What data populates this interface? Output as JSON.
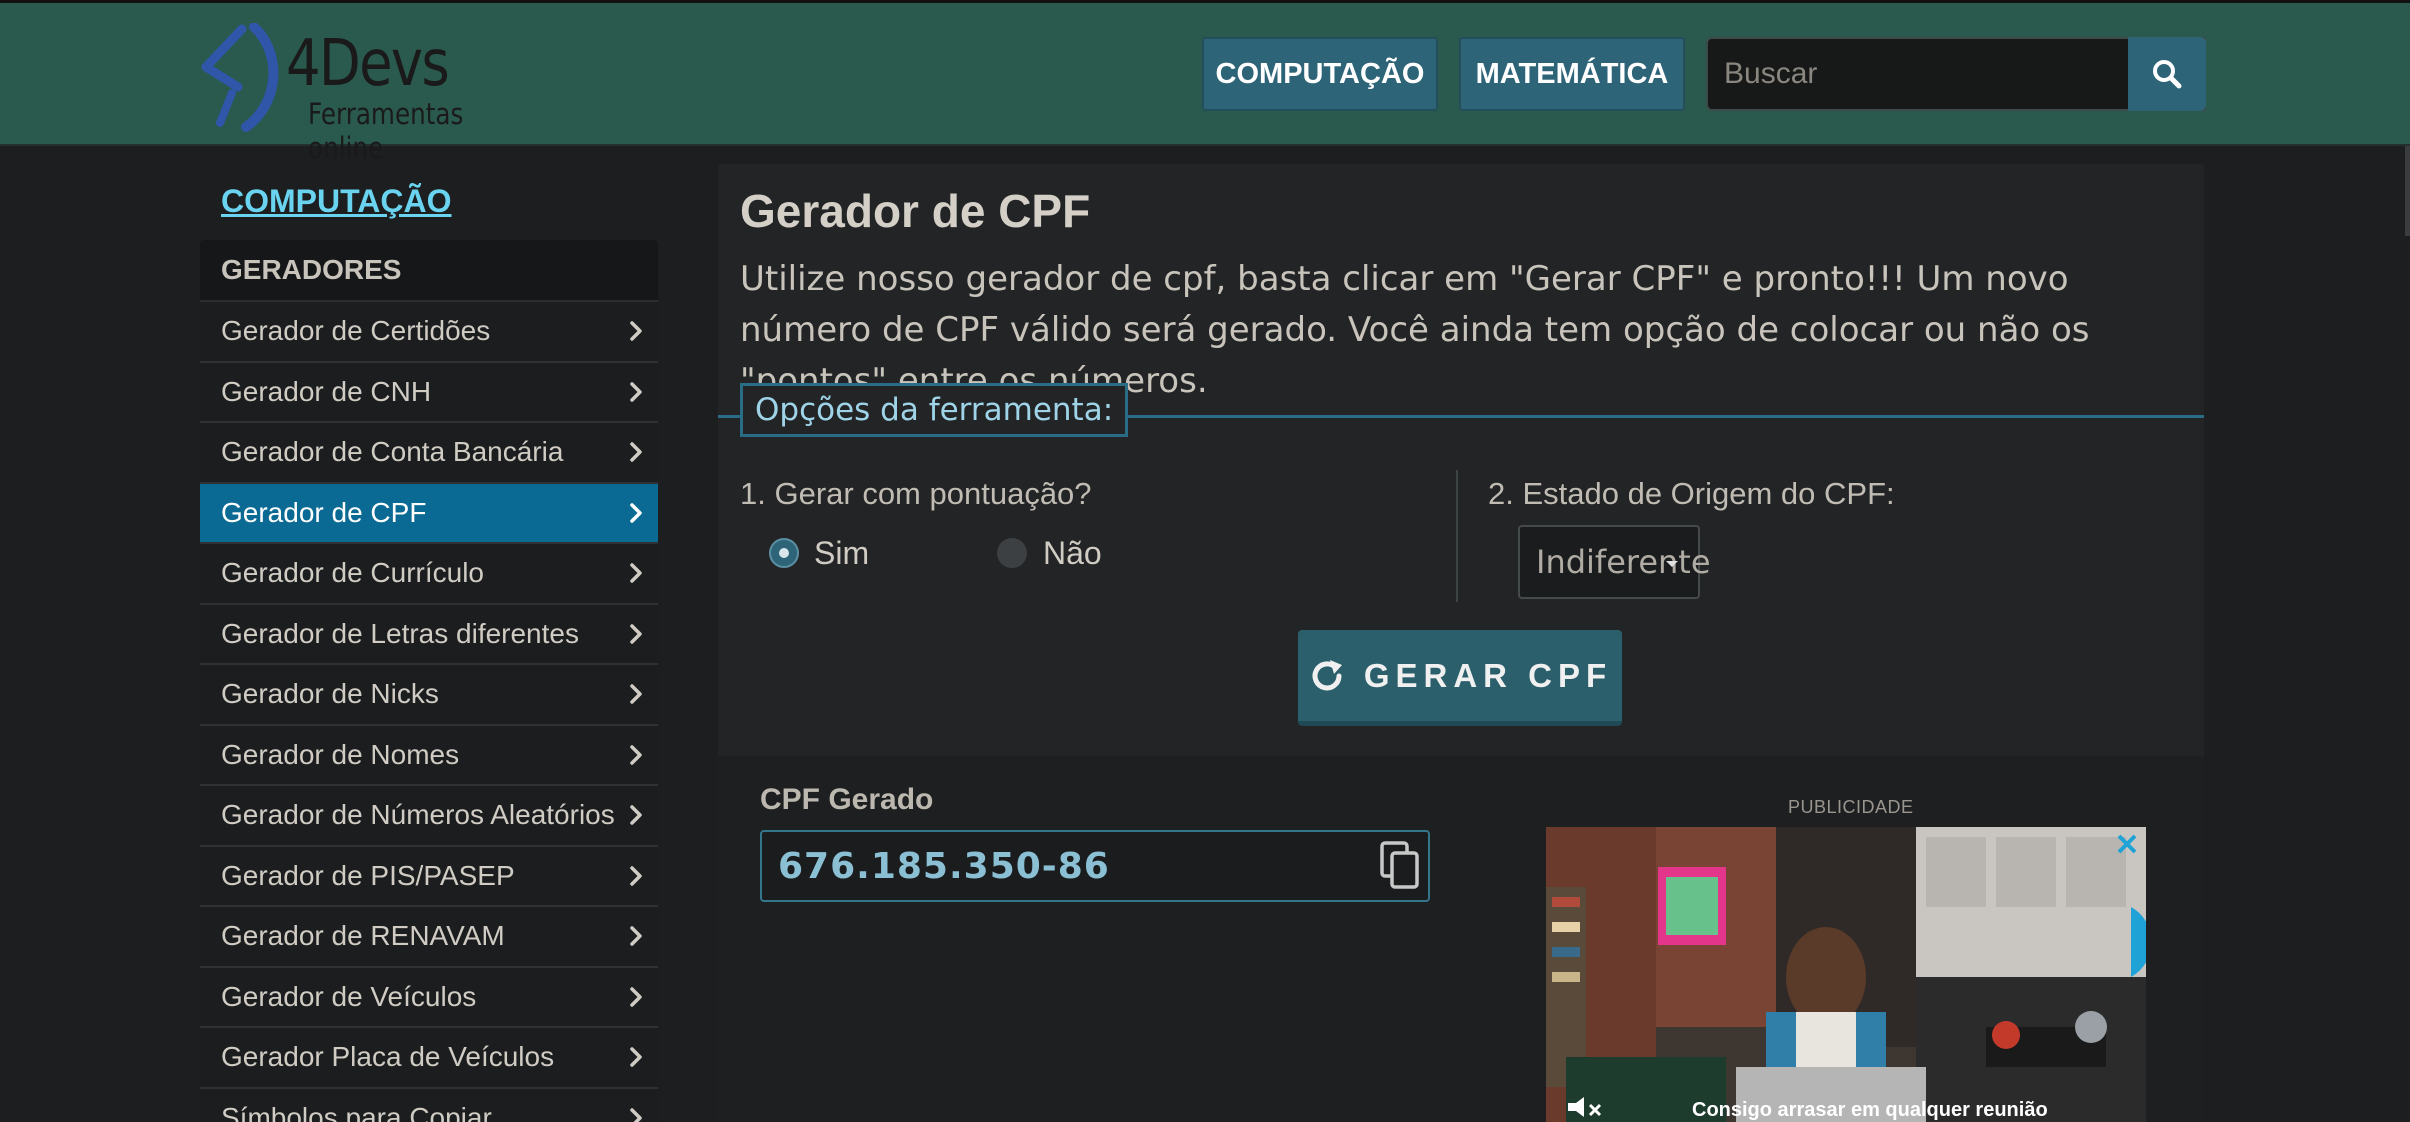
{
  "header": {
    "logo_title": "4Devs",
    "logo_subtitle": "Ferramentas online",
    "nav": [
      {
        "label": "COMPUTAÇÃO"
      },
      {
        "label": "MATEMÁTICA"
      }
    ],
    "search_placeholder": "Buscar",
    "search_icon": "search-icon"
  },
  "sidebar": {
    "heading": "COMPUTAÇÃO",
    "section": "GERADORES",
    "items": [
      {
        "label": "Gerador de Certidões",
        "active": false
      },
      {
        "label": "Gerador de CNH",
        "active": false
      },
      {
        "label": "Gerador de Conta Bancária",
        "active": false
      },
      {
        "label": "Gerador de CPF",
        "active": true
      },
      {
        "label": "Gerador de Currículo",
        "active": false
      },
      {
        "label": "Gerador de Letras diferentes",
        "active": false
      },
      {
        "label": "Gerador de Nicks",
        "active": false
      },
      {
        "label": "Gerador de Nomes",
        "active": false
      },
      {
        "label": "Gerador de Números Aleatórios",
        "active": false
      },
      {
        "label": "Gerador de PIS/PASEP",
        "active": false
      },
      {
        "label": "Gerador de RENAVAM",
        "active": false
      },
      {
        "label": "Gerador de Veículos",
        "active": false
      },
      {
        "label": "Gerador Placa de Veículos",
        "active": false
      },
      {
        "label": "Símbolos para Copiar",
        "active": false
      }
    ]
  },
  "main": {
    "title": "Gerador de CPF",
    "description": "Utilize nosso gerador de cpf, basta clicar em \"Gerar CPF\" e pronto!!! Um novo número de CPF válido será gerado. Você ainda tem opção de colocar ou não os \"pontos\" entre os números.",
    "options_legend": "Opções da ferramenta:",
    "option1_label": "1. Gerar com pontuação?",
    "option1_choices": [
      {
        "label": "Sim",
        "checked": true
      },
      {
        "label": "Não",
        "checked": false
      }
    ],
    "option2_label": "2. Estado de Origem do CPF:",
    "option2_value": "Indiferente",
    "generate_button": "GERAR CPF"
  },
  "result": {
    "label": "CPF Gerado",
    "value": "676.185.350-86"
  },
  "ad": {
    "label": "PUBLICIDADE",
    "caption": "Consigo arrasar em qualquer reunião"
  },
  "colors": {
    "header_bg": "#2a5a4e",
    "accent": "#2e6478",
    "active_item": "#0a6a94",
    "link": "#6ad4f0"
  }
}
